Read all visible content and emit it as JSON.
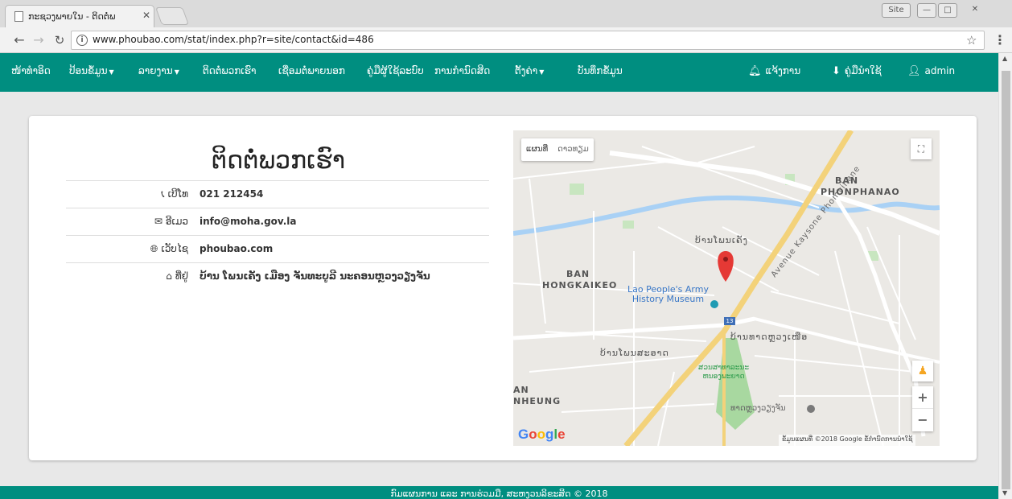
{
  "browser": {
    "tab_title": "ກະຊວງພາຍໃນ - ຕິດຕໍ່ພ",
    "url": "www.phoubao.com/stat/index.php?r=site/contact&id=486",
    "user_button": "Site"
  },
  "navbar": {
    "items": [
      {
        "label": "ໜ້າທຳອິດ",
        "dropdown": false
      },
      {
        "label": "ປ້ອນຂໍ້ມູນ",
        "dropdown": true
      },
      {
        "label": "ລາຍງານ",
        "dropdown": true
      },
      {
        "label": "ຕິດຕໍ່ພວກເຮົາ",
        "dropdown": false
      },
      {
        "label": "ເຊື່ອມຕໍ່ພາຍນອກ",
        "dropdown": false
      },
      {
        "label": "ຄູ່ມືຜູ້ໃຊ້ລະບົບ",
        "dropdown": false
      },
      {
        "label": "ການກຳນົດສິດ",
        "dropdown": false
      },
      {
        "label": "ຕັ້ງຄ່າ",
        "dropdown": true
      },
      {
        "label": "ບັນທຶກຂໍ້ມູນ",
        "dropdown": false
      }
    ],
    "right": {
      "notify": "ແຈ້ງການ",
      "manual": "ຄູ່ມືນຳໃຊ້",
      "user": "admin"
    },
    "color": "#008e80"
  },
  "contact": {
    "title": "ຕິດຕໍ່ພວກເຮົາ",
    "rows": [
      {
        "label": "ເບີໂທ",
        "value": "021 212454"
      },
      {
        "label": "ອີເມວ",
        "value": "info@moha.gov.la"
      },
      {
        "label": "ເວັບໄຊ",
        "value": "phoubao.com"
      },
      {
        "label": "ທີ່ຢູ່",
        "value": "ບ້ານ ໂພນເຄັງ ເມືອງ ຈັນທະບູລີ ນະຄອນຫຼວງວຽງຈັນ"
      }
    ]
  },
  "map": {
    "tab_map": "ແຜນທີ່",
    "tab_satellite": "ດາວທຽມ",
    "labels": {
      "ban_phonphanao_1": "BAN",
      "ban_phonphanao_2": "PHONPHANAO",
      "ban_hongkaikeo_1": "BAN",
      "ban_hongkaikeo_2": "HONGKAIKEO",
      "ban_nheung_1": "AN",
      "ban_nheung_2": "NHEUNG",
      "phonkheng": "ບ້ານໂພນເຄັງ",
      "phonsaat": "ບ້ານໂພນສະອາດ",
      "thatluang": "ບ້ານທາດຫຼວງເໜືອ",
      "road": "Avenue Kaysone Phomvihane",
      "museum": "Lao People's Army\nHistory Museum",
      "park": "ສວນສາທາລະນະ\nຫນອງພະຍາດ",
      "that_luang_stupa": "ທາດຫຼວງວຽງຈັນ",
      "route": "13"
    },
    "google": "Google",
    "attribution": "ຂໍ້ມູນແຜນທີ່ ©2018 Google   ຂໍ້ກຳນົດການນຳໃຊ້"
  },
  "footer": {
    "text": "ກົມແຜນການ ແລະ ການຮ່ວມມື, ສະຫງວນລິຂະສິດ © 2018"
  }
}
